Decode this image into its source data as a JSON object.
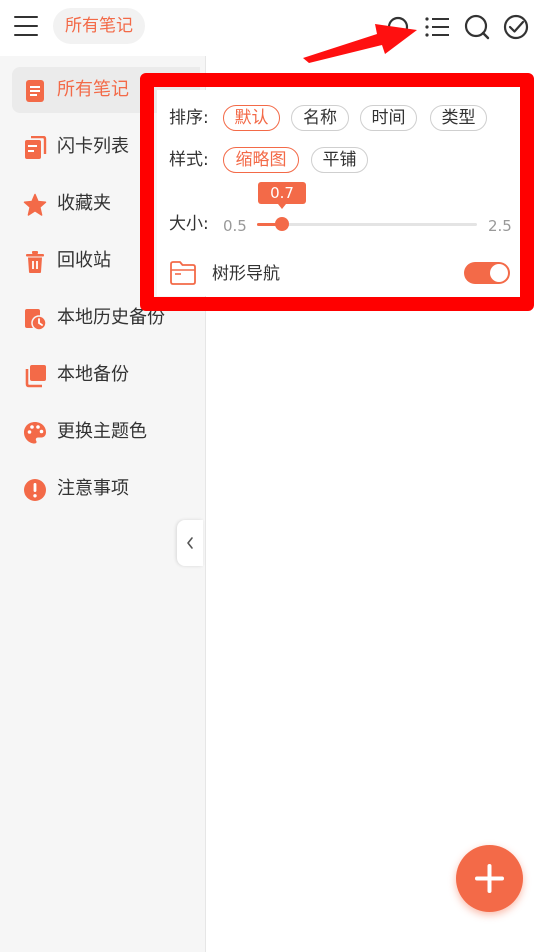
{
  "header": {
    "title": "所有笔记"
  },
  "sidebar": {
    "items": [
      {
        "label": "所有笔记",
        "icon": "note-list-icon",
        "active": true
      },
      {
        "label": "闪卡列表",
        "icon": "flashcards-icon"
      },
      {
        "label": "收藏夹",
        "icon": "star-icon"
      },
      {
        "label": "回收站",
        "icon": "trash-icon"
      },
      {
        "label": "本地历史备份",
        "icon": "history-backup-icon"
      },
      {
        "label": "本地备份",
        "icon": "backup-icon"
      },
      {
        "label": "更换主题色",
        "icon": "palette-icon"
      },
      {
        "label": "注意事项",
        "icon": "alert-icon"
      }
    ]
  },
  "panel": {
    "sort_label": "排序:",
    "sort_options": [
      "默认",
      "名称",
      "时间",
      "类型"
    ],
    "sort_selected": "默认",
    "style_label": "样式:",
    "style_options": [
      "缩略图",
      "平铺"
    ],
    "style_selected": "缩略图",
    "size_label": "大小:",
    "size_min": "0.5",
    "size_max": "2.5",
    "size_value": "0.7",
    "size_value_num": 0.7,
    "size_min_num": 0.5,
    "size_max_num": 2.5,
    "tree_nav_label": "树形导航",
    "tree_nav_enabled": true
  },
  "colors": {
    "accent": "#f36a48",
    "annotation": "#ff0000"
  }
}
